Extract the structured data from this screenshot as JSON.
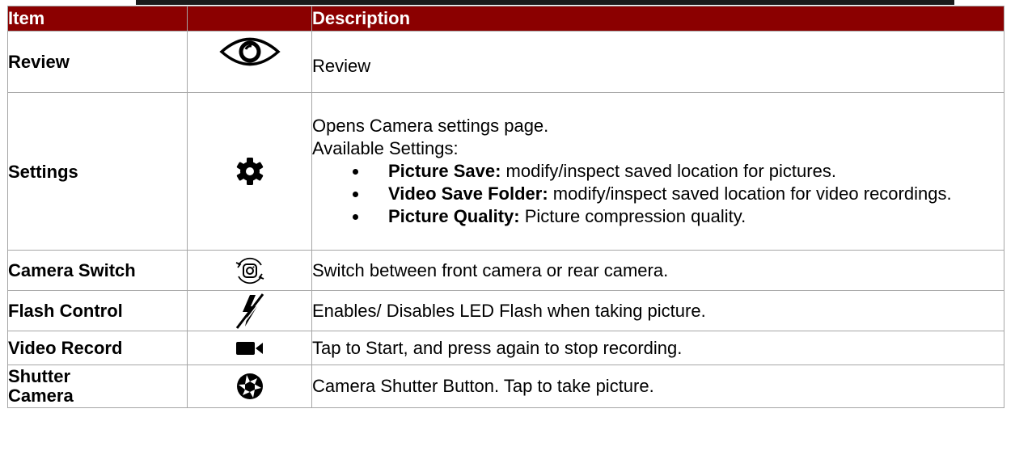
{
  "header": {
    "item_label": "Item",
    "description_label": "Description"
  },
  "rows": [
    {
      "item": "Review",
      "icon": "eye-icon",
      "description": "Review"
    },
    {
      "item": "Settings",
      "icon": "gear-icon",
      "description_lines": [
        "Opens Camera settings page.",
        "Available Settings:"
      ],
      "bullets": [
        {
          "term": "Picture Save:",
          "text": " modify/inspect saved location for pictures."
        },
        {
          "term": "Video Save Folder:",
          "text": " modify/inspect saved location for video recordings."
        },
        {
          "term": "Picture Quality:",
          "text": " Picture compression quality."
        }
      ]
    },
    {
      "item": "Camera Switch",
      "icon": "camera-switch-icon",
      "description": "Switch between front camera or rear camera."
    },
    {
      "item": "Flash Control",
      "icon": "flash-off-icon",
      "description": "Enables/ Disables LED Flash when taking picture."
    },
    {
      "item": "Video Record",
      "icon": "video-camera-icon",
      "description": "Tap to Start, and press again to stop recording."
    },
    {
      "item_lines": [
        "Shutter",
        "Camera"
      ],
      "icon": "shutter-icon",
      "description": "Camera Shutter Button. Tap to take picture."
    }
  ],
  "colors": {
    "header_bg": "#8b0000",
    "header_text": "#ffffff",
    "border": "#a6a6a6"
  }
}
